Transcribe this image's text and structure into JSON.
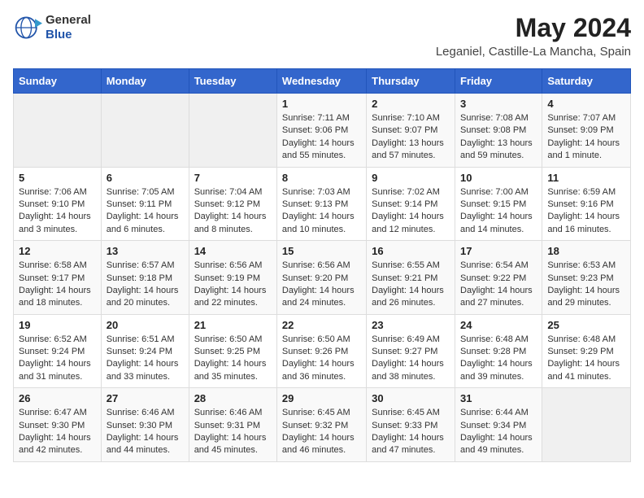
{
  "header": {
    "logo_line1": "General",
    "logo_line2": "Blue",
    "main_title": "May 2024",
    "subtitle": "Leganiel, Castille-La Mancha, Spain"
  },
  "days_of_week": [
    "Sunday",
    "Monday",
    "Tuesday",
    "Wednesday",
    "Thursday",
    "Friday",
    "Saturday"
  ],
  "weeks": [
    [
      {
        "day": "",
        "info": ""
      },
      {
        "day": "",
        "info": ""
      },
      {
        "day": "",
        "info": ""
      },
      {
        "day": "1",
        "info": "Sunrise: 7:11 AM\nSunset: 9:06 PM\nDaylight: 14 hours\nand 55 minutes."
      },
      {
        "day": "2",
        "info": "Sunrise: 7:10 AM\nSunset: 9:07 PM\nDaylight: 13 hours\nand 57 minutes."
      },
      {
        "day": "3",
        "info": "Sunrise: 7:08 AM\nSunset: 9:08 PM\nDaylight: 13 hours\nand 59 minutes."
      },
      {
        "day": "4",
        "info": "Sunrise: 7:07 AM\nSunset: 9:09 PM\nDaylight: 14 hours\nand 1 minute."
      }
    ],
    [
      {
        "day": "5",
        "info": "Sunrise: 7:06 AM\nSunset: 9:10 PM\nDaylight: 14 hours\nand 3 minutes."
      },
      {
        "day": "6",
        "info": "Sunrise: 7:05 AM\nSunset: 9:11 PM\nDaylight: 14 hours\nand 6 minutes."
      },
      {
        "day": "7",
        "info": "Sunrise: 7:04 AM\nSunset: 9:12 PM\nDaylight: 14 hours\nand 8 minutes."
      },
      {
        "day": "8",
        "info": "Sunrise: 7:03 AM\nSunset: 9:13 PM\nDaylight: 14 hours\nand 10 minutes."
      },
      {
        "day": "9",
        "info": "Sunrise: 7:02 AM\nSunset: 9:14 PM\nDaylight: 14 hours\nand 12 minutes."
      },
      {
        "day": "10",
        "info": "Sunrise: 7:00 AM\nSunset: 9:15 PM\nDaylight: 14 hours\nand 14 minutes."
      },
      {
        "day": "11",
        "info": "Sunrise: 6:59 AM\nSunset: 9:16 PM\nDaylight: 14 hours\nand 16 minutes."
      }
    ],
    [
      {
        "day": "12",
        "info": "Sunrise: 6:58 AM\nSunset: 9:17 PM\nDaylight: 14 hours\nand 18 minutes."
      },
      {
        "day": "13",
        "info": "Sunrise: 6:57 AM\nSunset: 9:18 PM\nDaylight: 14 hours\nand 20 minutes."
      },
      {
        "day": "14",
        "info": "Sunrise: 6:56 AM\nSunset: 9:19 PM\nDaylight: 14 hours\nand 22 minutes."
      },
      {
        "day": "15",
        "info": "Sunrise: 6:56 AM\nSunset: 9:20 PM\nDaylight: 14 hours\nand 24 minutes."
      },
      {
        "day": "16",
        "info": "Sunrise: 6:55 AM\nSunset: 9:21 PM\nDaylight: 14 hours\nand 26 minutes."
      },
      {
        "day": "17",
        "info": "Sunrise: 6:54 AM\nSunset: 9:22 PM\nDaylight: 14 hours\nand 27 minutes."
      },
      {
        "day": "18",
        "info": "Sunrise: 6:53 AM\nSunset: 9:23 PM\nDaylight: 14 hours\nand 29 minutes."
      }
    ],
    [
      {
        "day": "19",
        "info": "Sunrise: 6:52 AM\nSunset: 9:24 PM\nDaylight: 14 hours\nand 31 minutes."
      },
      {
        "day": "20",
        "info": "Sunrise: 6:51 AM\nSunset: 9:24 PM\nDaylight: 14 hours\nand 33 minutes."
      },
      {
        "day": "21",
        "info": "Sunrise: 6:50 AM\nSunset: 9:25 PM\nDaylight: 14 hours\nand 35 minutes."
      },
      {
        "day": "22",
        "info": "Sunrise: 6:50 AM\nSunset: 9:26 PM\nDaylight: 14 hours\nand 36 minutes."
      },
      {
        "day": "23",
        "info": "Sunrise: 6:49 AM\nSunset: 9:27 PM\nDaylight: 14 hours\nand 38 minutes."
      },
      {
        "day": "24",
        "info": "Sunrise: 6:48 AM\nSunset: 9:28 PM\nDaylight: 14 hours\nand 39 minutes."
      },
      {
        "day": "25",
        "info": "Sunrise: 6:48 AM\nSunset: 9:29 PM\nDaylight: 14 hours\nand 41 minutes."
      }
    ],
    [
      {
        "day": "26",
        "info": "Sunrise: 6:47 AM\nSunset: 9:30 PM\nDaylight: 14 hours\nand 42 minutes."
      },
      {
        "day": "27",
        "info": "Sunrise: 6:46 AM\nSunset: 9:30 PM\nDaylight: 14 hours\nand 44 minutes."
      },
      {
        "day": "28",
        "info": "Sunrise: 6:46 AM\nSunset: 9:31 PM\nDaylight: 14 hours\nand 45 minutes."
      },
      {
        "day": "29",
        "info": "Sunrise: 6:45 AM\nSunset: 9:32 PM\nDaylight: 14 hours\nand 46 minutes."
      },
      {
        "day": "30",
        "info": "Sunrise: 6:45 AM\nSunset: 9:33 PM\nDaylight: 14 hours\nand 47 minutes."
      },
      {
        "day": "31",
        "info": "Sunrise: 6:44 AM\nSunset: 9:34 PM\nDaylight: 14 hours\nand 49 minutes."
      },
      {
        "day": "",
        "info": ""
      }
    ]
  ]
}
